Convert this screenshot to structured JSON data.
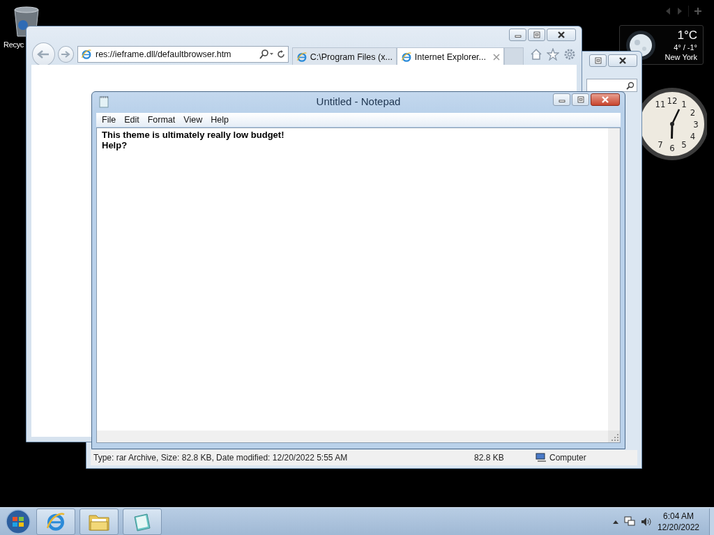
{
  "desktop": {
    "icons": [
      {
        "label": "Recyc"
      }
    ]
  },
  "gadgets": {
    "weather": {
      "temperature": "1°C",
      "range": "4° / -1°",
      "city": "New York"
    },
    "clock": {
      "numerals": [
        "11",
        "12",
        "1",
        "2",
        "3",
        "4",
        "5",
        "6",
        "7"
      ]
    }
  },
  "explorer_window": {
    "status_bar": [
      "Type: rar Archive, Size: 82.8 KB, Date modified: 12/20/2022 5:55 AM",
      "82.8 KB",
      "Computer"
    ]
  },
  "browser_window": {
    "address": "res://ieframe.dll/defaultbrowser.htm",
    "tabs": [
      {
        "label": "C:\\Program Files (x...",
        "selected": false
      },
      {
        "label": "Internet Explorer...",
        "selected": true
      }
    ]
  },
  "notepad": {
    "title": "Untitled - Notepad",
    "menu": [
      "File",
      "Edit",
      "Format",
      "View",
      "Help"
    ],
    "text": [
      "This theme is ultimately really low budget!",
      "Help?"
    ]
  },
  "taskbar": {
    "apps": [
      {
        "kind": "browser"
      },
      {
        "kind": "folder"
      },
      {
        "kind": "notepad"
      }
    ],
    "time": "6:04 AM",
    "date": "12/20/2022"
  }
}
